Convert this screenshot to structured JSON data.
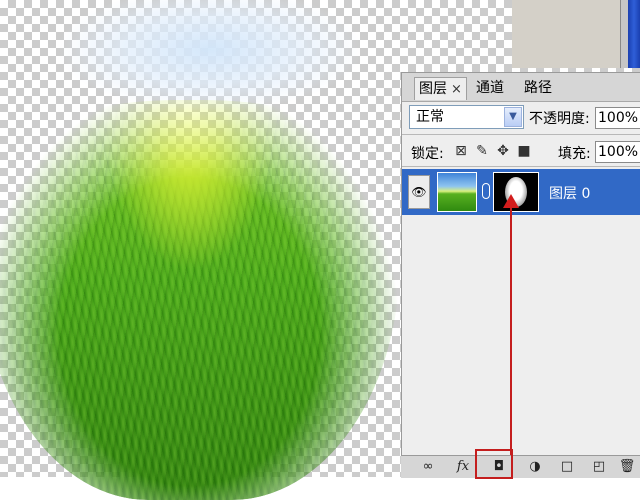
{
  "panel": {
    "tabs": [
      {
        "label": "图层",
        "close": "×"
      },
      {
        "label": "通道"
      },
      {
        "label": "路径"
      }
    ],
    "blend_mode": "正常",
    "opacity_label": "不透明度:",
    "opacity_value": "100%",
    "lock_label": "锁定:",
    "fill_label": "填充:",
    "fill_value": "100%",
    "lock_icons": [
      "lock-transparent-icon",
      "lock-brush-icon",
      "lock-move-icon",
      "lock-all-icon"
    ]
  },
  "layers": [
    {
      "name": "图层 0",
      "visible": true,
      "has_mask": true,
      "selected": true
    }
  ],
  "toolbar": {
    "link": "∞",
    "fx": "fx",
    "mask": "◘",
    "adjust": "◑",
    "group": "□",
    "new": "◰",
    "delete": "🗑"
  },
  "annotation": {
    "color": "#c41e1e"
  },
  "colors": {
    "selection": "#3169c6",
    "panel_bg": "#eeeeee"
  }
}
